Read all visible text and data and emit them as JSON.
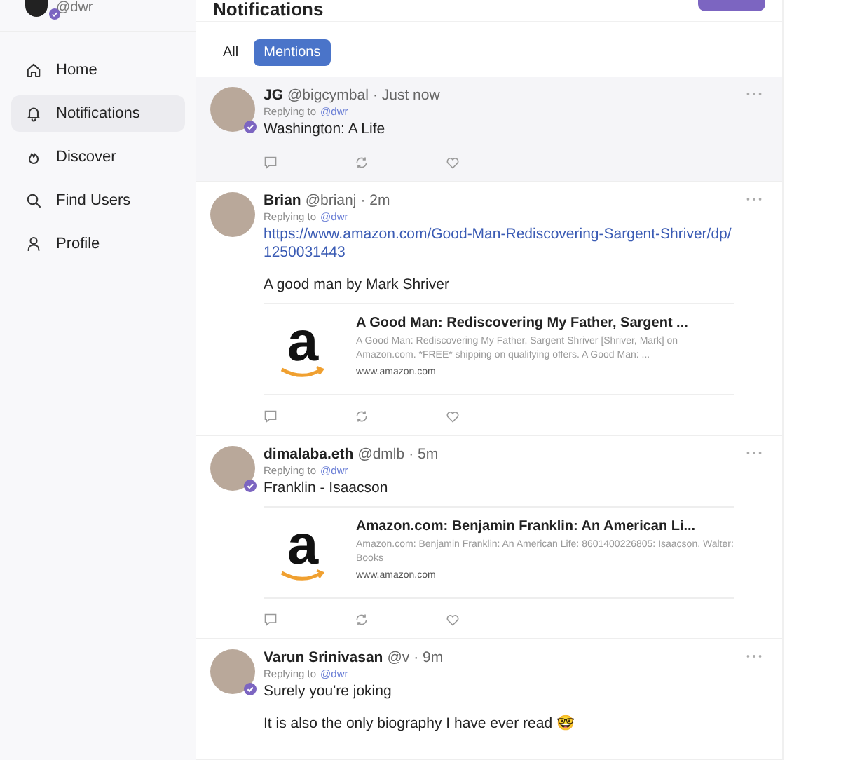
{
  "sidebar": {
    "user": {
      "handle": "@dwr",
      "verified": true
    },
    "nav": [
      {
        "label": "Home",
        "kind": "home",
        "selected": false
      },
      {
        "label": "Notifications",
        "kind": "bell",
        "selected": true
      },
      {
        "label": "Discover",
        "kind": "flame",
        "selected": false
      },
      {
        "label": "Find Users",
        "kind": "search",
        "selected": false
      },
      {
        "label": "Profile",
        "kind": "person",
        "selected": false
      }
    ]
  },
  "header": {
    "title": "Notifications"
  },
  "tabs": [
    {
      "label": "All",
      "selected": false
    },
    {
      "label": "Mentions",
      "selected": true
    }
  ],
  "posts": [
    {
      "name": "JG",
      "handle": "@bigcymbal",
      "time": "· Just now",
      "reply_prefix": "Replying to",
      "reply_to": "@dwr",
      "verified": true,
      "highlighted": true,
      "paragraphs": [
        "Washington: A Life"
      ]
    },
    {
      "name": "Brian",
      "handle": "@brianj",
      "time": "· 2m",
      "reply_prefix": "Replying to",
      "reply_to": "@dwr",
      "verified": false,
      "highlighted": false,
      "link": "https://www.amazon.com/Good-Man-Rediscovering-Sargent-Shriver/dp/1250031443",
      "paragraphs": [
        "A good man by Mark Shriver"
      ],
      "embed": {
        "logo_text": "a",
        "title": "A Good Man: Rediscovering My Father, Sargent ...",
        "description": "A Good Man: Rediscovering My Father, Sargent Shriver [Shriver, Mark] on Amazon.com. *FREE* shipping on qualifying offers. A Good Man: ...",
        "domain": "www.amazon.com"
      }
    },
    {
      "name": "dimalaba.eth",
      "handle": "@dmlb",
      "time": "· 5m",
      "reply_prefix": "Replying to",
      "reply_to": "@dwr",
      "verified": true,
      "highlighted": false,
      "paragraphs": [
        "Franklin - Isaacson"
      ],
      "embed": {
        "logo_text": "a",
        "title": "Amazon.com: Benjamin Franklin: An American Li...",
        "description": "Amazon.com: Benjamin Franklin: An American Life: 8601400226805: Isaacson, Walter: Books",
        "domain": "www.amazon.com"
      }
    },
    {
      "name": "Varun Srinivasan",
      "handle": "@v",
      "time": "· 9m",
      "reply_prefix": "Replying to",
      "reply_to": "@dwr",
      "verified": true,
      "highlighted": false,
      "paragraphs": [
        "Surely you're joking",
        "It is also the only biography I have ever read 🤓"
      ],
      "no_actions": true
    }
  ]
}
